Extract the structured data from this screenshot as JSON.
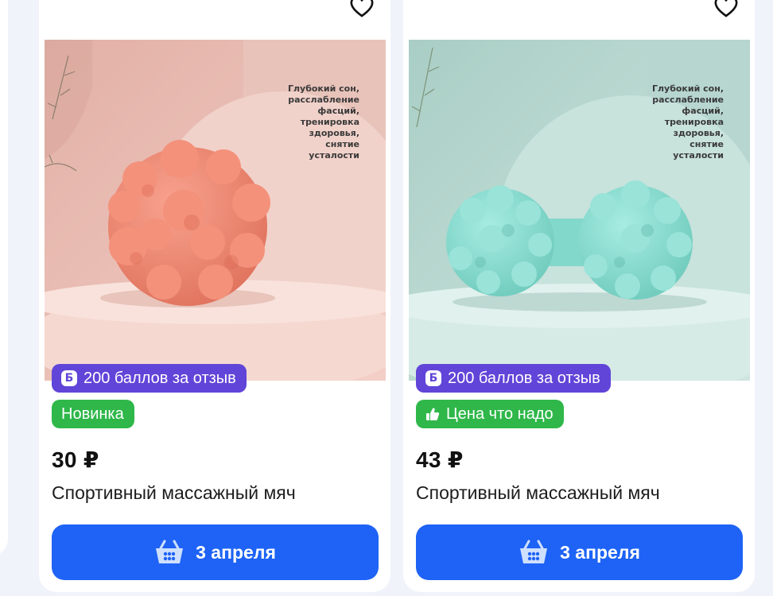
{
  "products": [
    {
      "image_caption_lines": [
        "Глубокий сон,",
        "расслабление",
        "фасций,",
        "тренировка",
        "здоровья,",
        "снятие",
        "усталости"
      ],
      "points_badge": "200 баллов за отзыв",
      "points_badge_icon": "Б",
      "second_badge": "Новинка",
      "second_badge_icon": "",
      "price": "30 ₽",
      "title": "Спортивный массажный мяч",
      "delivery_button": "3 апреля",
      "colors": {
        "product": "#f08b76",
        "background": "#e9c1b8"
      }
    },
    {
      "image_caption_lines": [
        "Глубокий сон,",
        "расслабление",
        "фасций,",
        "тренировка",
        "здоровья,",
        "снятие",
        "усталости"
      ],
      "points_badge": "200 баллов за отзыв",
      "points_badge_icon": "Б",
      "second_badge": "Цена что надо",
      "second_badge_icon": "thumbs-up-icon",
      "price": "43 ₽",
      "title": "Спортивный массажный мяч",
      "delivery_button": "3 апреля",
      "colors": {
        "product": "#8fded2",
        "background": "#b9d8d1"
      }
    }
  ],
  "colors": {
    "accent_blue": "#1e63f5",
    "points_purple": "#6145d8",
    "badge_green": "#2fb74a",
    "page_background": "#f1f3fa"
  },
  "icons": {
    "favorite": "heart-icon",
    "cart": "basket-icon"
  }
}
